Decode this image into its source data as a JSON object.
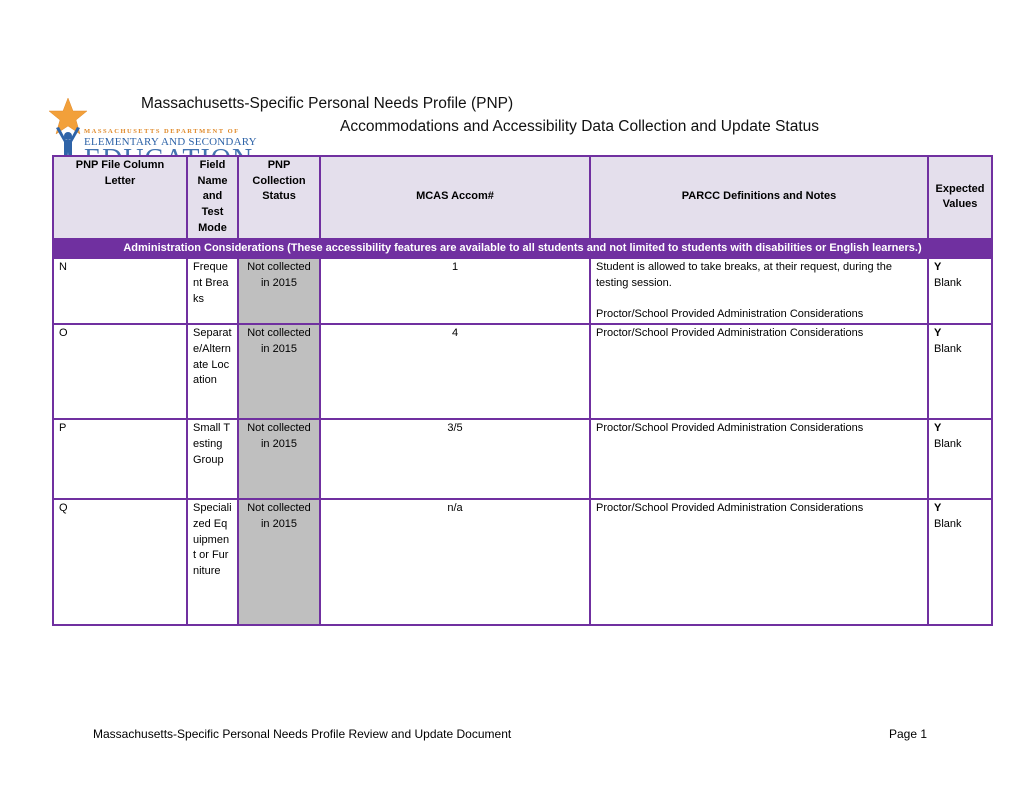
{
  "header": {
    "title": "Massachusetts-Specific Personal Needs Profile (PNP)",
    "subtitle": "Accommodations and Accessibility Data Collection and Update Status",
    "logo": {
      "line1": "MASSACHUSETTS DEPARTMENT OF",
      "line2": "ELEMENTARY AND SECONDARY",
      "line3": "EDUCATION",
      "icon": "star-person-icon"
    }
  },
  "table": {
    "columns": [
      "PNP File Column Letter",
      "Field Name and Test Mode",
      "PNP Collection Status",
      "MCAS Accom#",
      "PARCC  Definitions and Notes",
      "Expected Values"
    ],
    "section": "Administration Considerations (These accessibility features are available to all students and not limited to students with disabilities or English learners.)",
    "rows": [
      {
        "letter": "N",
        "field": "Frequent Breaks",
        "status": "Not collected in 2015",
        "mcas": "1",
        "parcc": "Student is allowed to take breaks, at their request, during the testing session.",
        "parcc_note": "Proctor/School Provided Administration Considerations",
        "expected_bold": "Y",
        "expected": "Blank"
      },
      {
        "letter": "O",
        "field": "Separate/Alternate Location",
        "status": "Not collected in 2015",
        "mcas": "4",
        "parcc": "Proctor/School Provided Administration Considerations",
        "parcc_note": "",
        "expected_bold": "Y",
        "expected": "Blank"
      },
      {
        "letter": "P",
        "field": "Small Testing Group",
        "status": "Not collected in 2015",
        "mcas": "3/5",
        "parcc": "Proctor/School Provided Administration Considerations",
        "parcc_note": "",
        "expected_bold": "Y",
        "expected": "Blank"
      },
      {
        "letter": "Q",
        "field": "Specialized Equipment or Furniture",
        "status": "Not collected in 2015",
        "mcas": "n/a",
        "parcc": "Proctor/School Provided Administration Considerations",
        "parcc_note": "",
        "expected_bold": "Y",
        "expected": "Blank"
      }
    ]
  },
  "footer": {
    "document": "Massachusetts-Specific Personal Needs Profile Review and Update Document",
    "page": "Page 1"
  }
}
